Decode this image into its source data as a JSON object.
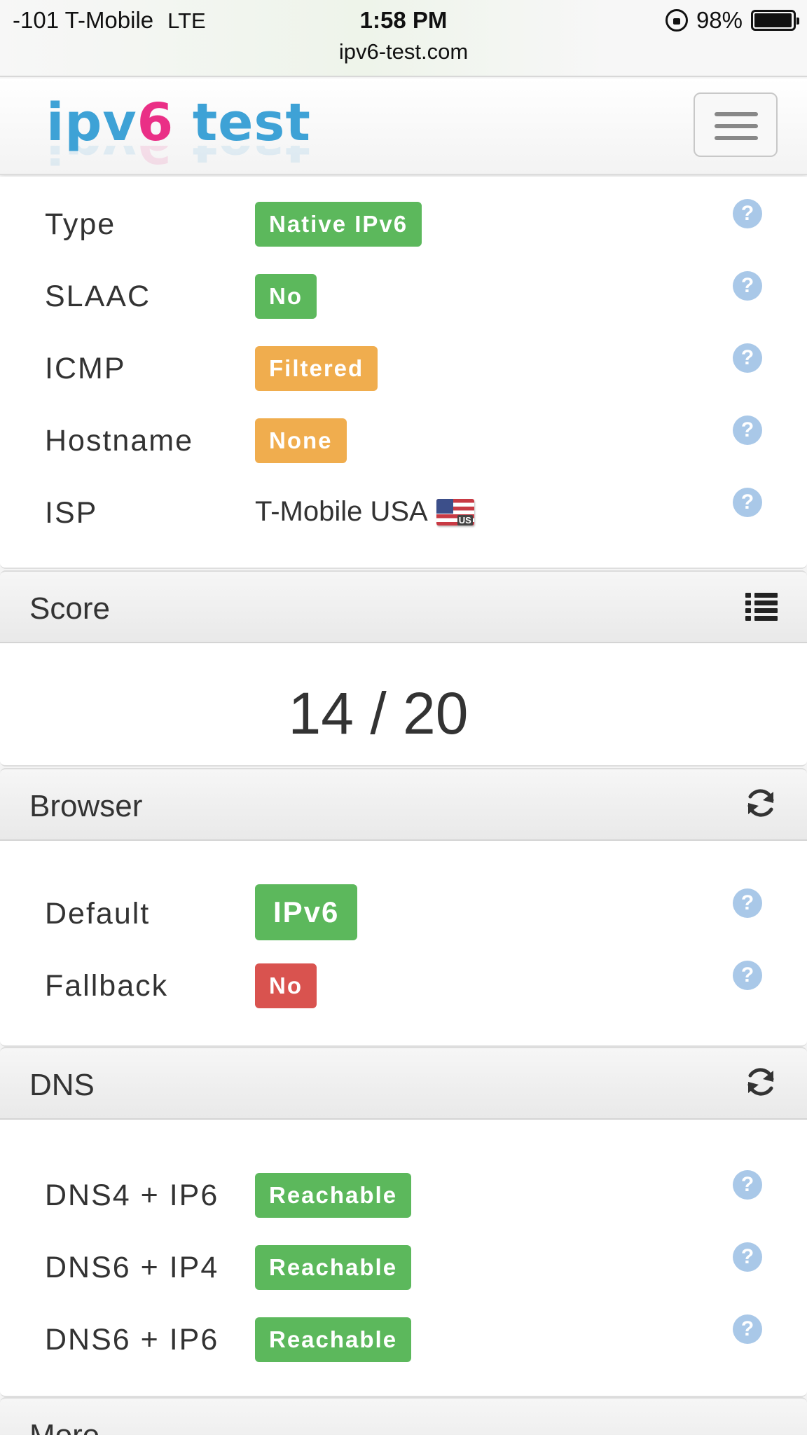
{
  "status_bar": {
    "signal": "-101 T-Mobile",
    "network": "LTE",
    "time": "1:58 PM",
    "battery": "98%",
    "battery_level": 0.98,
    "url": "ipv6-test.com"
  },
  "navbar": {
    "logo_part1": "ipv",
    "logo_part2": "6",
    "logo_part3": " test",
    "menu_icon": "hamburger-icon"
  },
  "connection": {
    "rows": [
      {
        "label": "Type",
        "value": "Native IPv6",
        "color": "#5cb85c"
      },
      {
        "label": "SLAAC",
        "value": "No",
        "color": "#5cb85c"
      },
      {
        "label": "ICMP",
        "value": "Filtered",
        "color": "#f0ad4e"
      },
      {
        "label": "Hostname",
        "value": "None",
        "color": "#f0ad4e"
      },
      {
        "label": "ISP",
        "value": "T-Mobile USA",
        "flag": "US"
      }
    ],
    "help_glyph": "?"
  },
  "score": {
    "title": "Score",
    "value": "14 / 20",
    "icon": "list-icon"
  },
  "browser": {
    "title": "Browser",
    "icon": "refresh-icon",
    "rows": [
      {
        "label": "Default",
        "value": "IPv6",
        "color": "#5cb85c"
      },
      {
        "label": "Fallback",
        "value": "No",
        "color": "#d9534f"
      }
    ]
  },
  "dns": {
    "title": "DNS",
    "icon": "refresh-icon",
    "rows": [
      {
        "label": "DNS4 + IP6",
        "value": "Reachable",
        "color": "#5cb85c"
      },
      {
        "label": "DNS6 + IP4",
        "value": "Reachable",
        "color": "#5cb85c"
      },
      {
        "label": "DNS6 + IP6",
        "value": "Reachable",
        "color": "#5cb85c"
      }
    ]
  },
  "more": {
    "title": "More"
  }
}
